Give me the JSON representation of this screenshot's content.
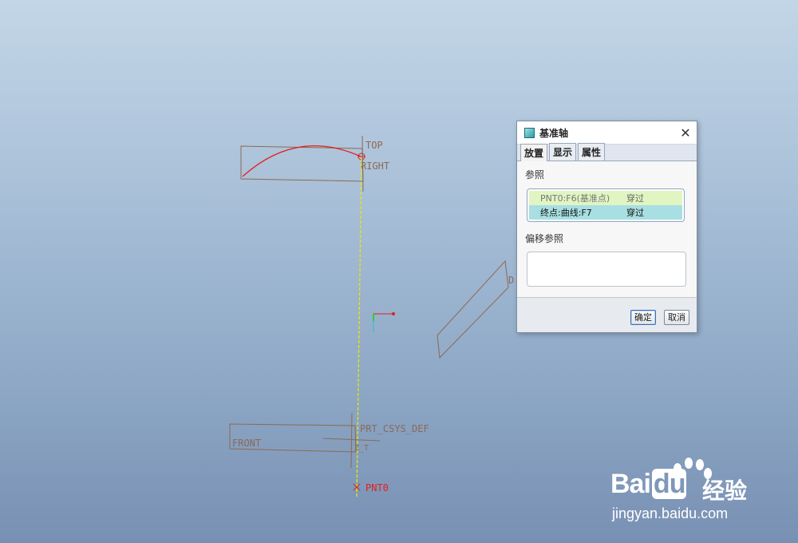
{
  "viewport": {
    "labels": {
      "top": "TOP",
      "right": "RIGHT",
      "front": "FRONT",
      "csys": "PRT_CSYS_DEF",
      "pnt0": "PNT0",
      "d": "D"
    },
    "colors": {
      "plane": "#8b6a55",
      "curve": "#e02020",
      "axis": "#e8e800",
      "point": "#e02020"
    }
  },
  "dialog": {
    "title": "基准轴",
    "close_icon": "close-icon",
    "tabs": [
      "放置",
      "显示",
      "属性"
    ],
    "references_label": "参照",
    "references": [
      {
        "name": "PNT0:F6(基准点)",
        "type": "穿过"
      },
      {
        "name": "终点:曲线:F7",
        "type": "穿过"
      }
    ],
    "offset_label": "偏移参照",
    "ok_label": "确定",
    "cancel_label": "取消"
  },
  "watermark": {
    "logo": "Bai",
    "logo_suffix": "du",
    "cn": "经验",
    "url": "jingyan.baidu.com"
  }
}
